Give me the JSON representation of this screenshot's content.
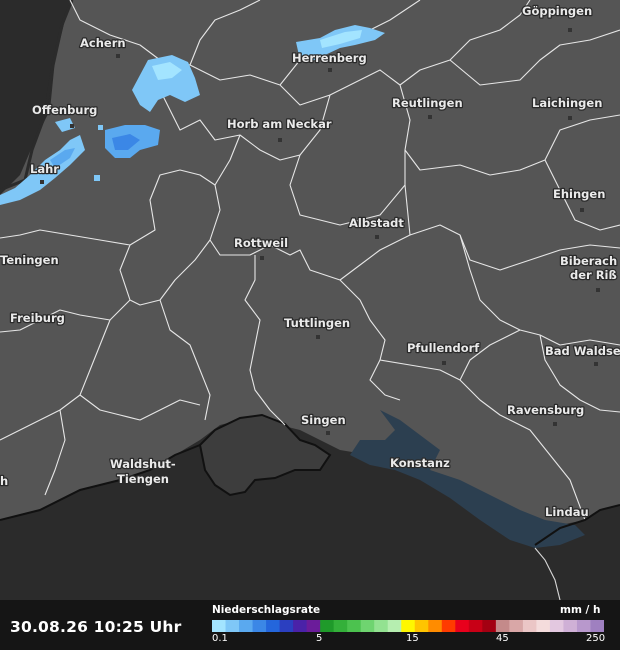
{
  "timestamp": "30.08.26 10:25 Uhr",
  "legend": {
    "title": "Niederschlagsrate",
    "unit": "mm / h",
    "ticks": [
      "0.1",
      "5",
      "15",
      "45",
      "250"
    ],
    "colors": [
      "#a3e4ff",
      "#7fc7f7",
      "#5aa9ef",
      "#3b87e6",
      "#2466dc",
      "#2b3fc0",
      "#4a22a8",
      "#6b1c9a",
      "#1f9a2a",
      "#34b03a",
      "#4cc24f",
      "#6fd470",
      "#93e291",
      "#b6eeb0",
      "#fff700",
      "#ffc400",
      "#ff8c00",
      "#ff3b00",
      "#e8001c",
      "#c80016",
      "#a30012",
      "#c48a8a",
      "#d9a7a7",
      "#ebc6c6",
      "#f4dcdc",
      "#e3c8e0",
      "#cfb0d6",
      "#b898cc",
      "#9f80c0"
    ]
  },
  "map": {
    "land_color": "#555555",
    "lake_color": "#2c3f50",
    "swiss_color": "#3d3d3d",
    "background_color": "#2b2b2b",
    "cities": [
      {
        "id": "goeppingen",
        "name": "Göppingen"
      },
      {
        "id": "achern",
        "name": "Achern"
      },
      {
        "id": "herrenberg",
        "name": "Herrenberg"
      },
      {
        "id": "reutlingen",
        "name": "Reutlingen"
      },
      {
        "id": "laichingen",
        "name": "Laichingen"
      },
      {
        "id": "offenburg",
        "name": "Offenburg"
      },
      {
        "id": "horb",
        "name": "Horb am Neckar"
      },
      {
        "id": "lahr",
        "name": "Lahr"
      },
      {
        "id": "ehingen",
        "name": "Ehingen"
      },
      {
        "id": "albstadt",
        "name": "Albstadt"
      },
      {
        "id": "rottweil",
        "name": "Rottweil"
      },
      {
        "id": "teningen",
        "name": "Teningen"
      },
      {
        "id": "biberach",
        "name": "Biberach"
      },
      {
        "id": "biberach2",
        "name": "der Riß"
      },
      {
        "id": "freiburg",
        "name": "Freiburg"
      },
      {
        "id": "tuttlingen",
        "name": "Tuttlingen"
      },
      {
        "id": "pfullendorf",
        "name": "Pfullendorf"
      },
      {
        "id": "badwaldsee",
        "name": "Bad Waldse"
      },
      {
        "id": "ravensburg",
        "name": "Ravensburg"
      },
      {
        "id": "singen",
        "name": "Singen"
      },
      {
        "id": "waldshut",
        "name": "Waldshut-"
      },
      {
        "id": "waldshut2",
        "name": "Tiengen"
      },
      {
        "id": "konstanz",
        "name": "Konstanz"
      },
      {
        "id": "lindau",
        "name": "Lindau"
      },
      {
        "id": "hedge",
        "name": "h"
      }
    ]
  }
}
